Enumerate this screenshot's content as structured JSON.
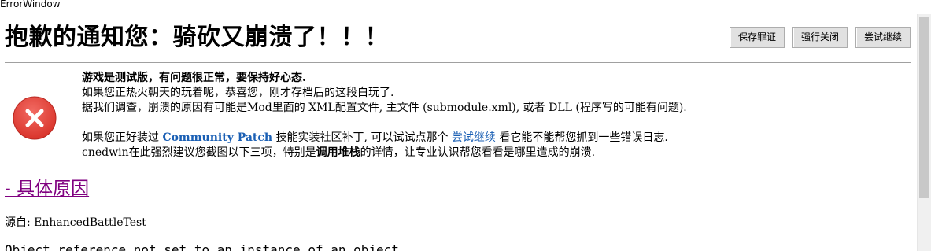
{
  "window": {
    "title": "ErrorWindow"
  },
  "header": {
    "title": "抱歉的通知您：骑砍又崩溃了！！！"
  },
  "buttons": {
    "save_evidence": "保存罪证",
    "force_close": "强行关闭",
    "try_continue": "尝试继续"
  },
  "icon": {
    "name": "error-icon",
    "color": "#e8403a"
  },
  "message": {
    "line1": "游戏是测试版，有问题很正常，要保持好心态.",
    "line2": "如果您正热火朝天的玩着呢，恭喜您，刚才存档后的这段白玩了.",
    "line3": "据我们调查，崩溃的原因有可能是Mod里面的  XML配置文件, 主文件  (submodule.xml), 或者  DLL (程序写的可能有问题).",
    "line4_pre": "如果您正好装过  ",
    "line4_link": "Community Patch",
    "line4_mid": " 技能实装社区补丁, 可以试试点那个  ",
    "line4_link2": "尝试继续",
    "line4_post": "  看它能不能帮您抓到一些错误日志.",
    "line5_pre": "cnedwin在此强烈建议您截图以下三项，特别是",
    "line5_bold": "调用堆栈",
    "line5_post": "的详情，让专业认识帮您看看是哪里造成的崩溃."
  },
  "details": {
    "reason_link": "- 具体原因",
    "source": "源自: EnhancedBattleTest",
    "exception": "Object reference not set to an instance of an object."
  }
}
